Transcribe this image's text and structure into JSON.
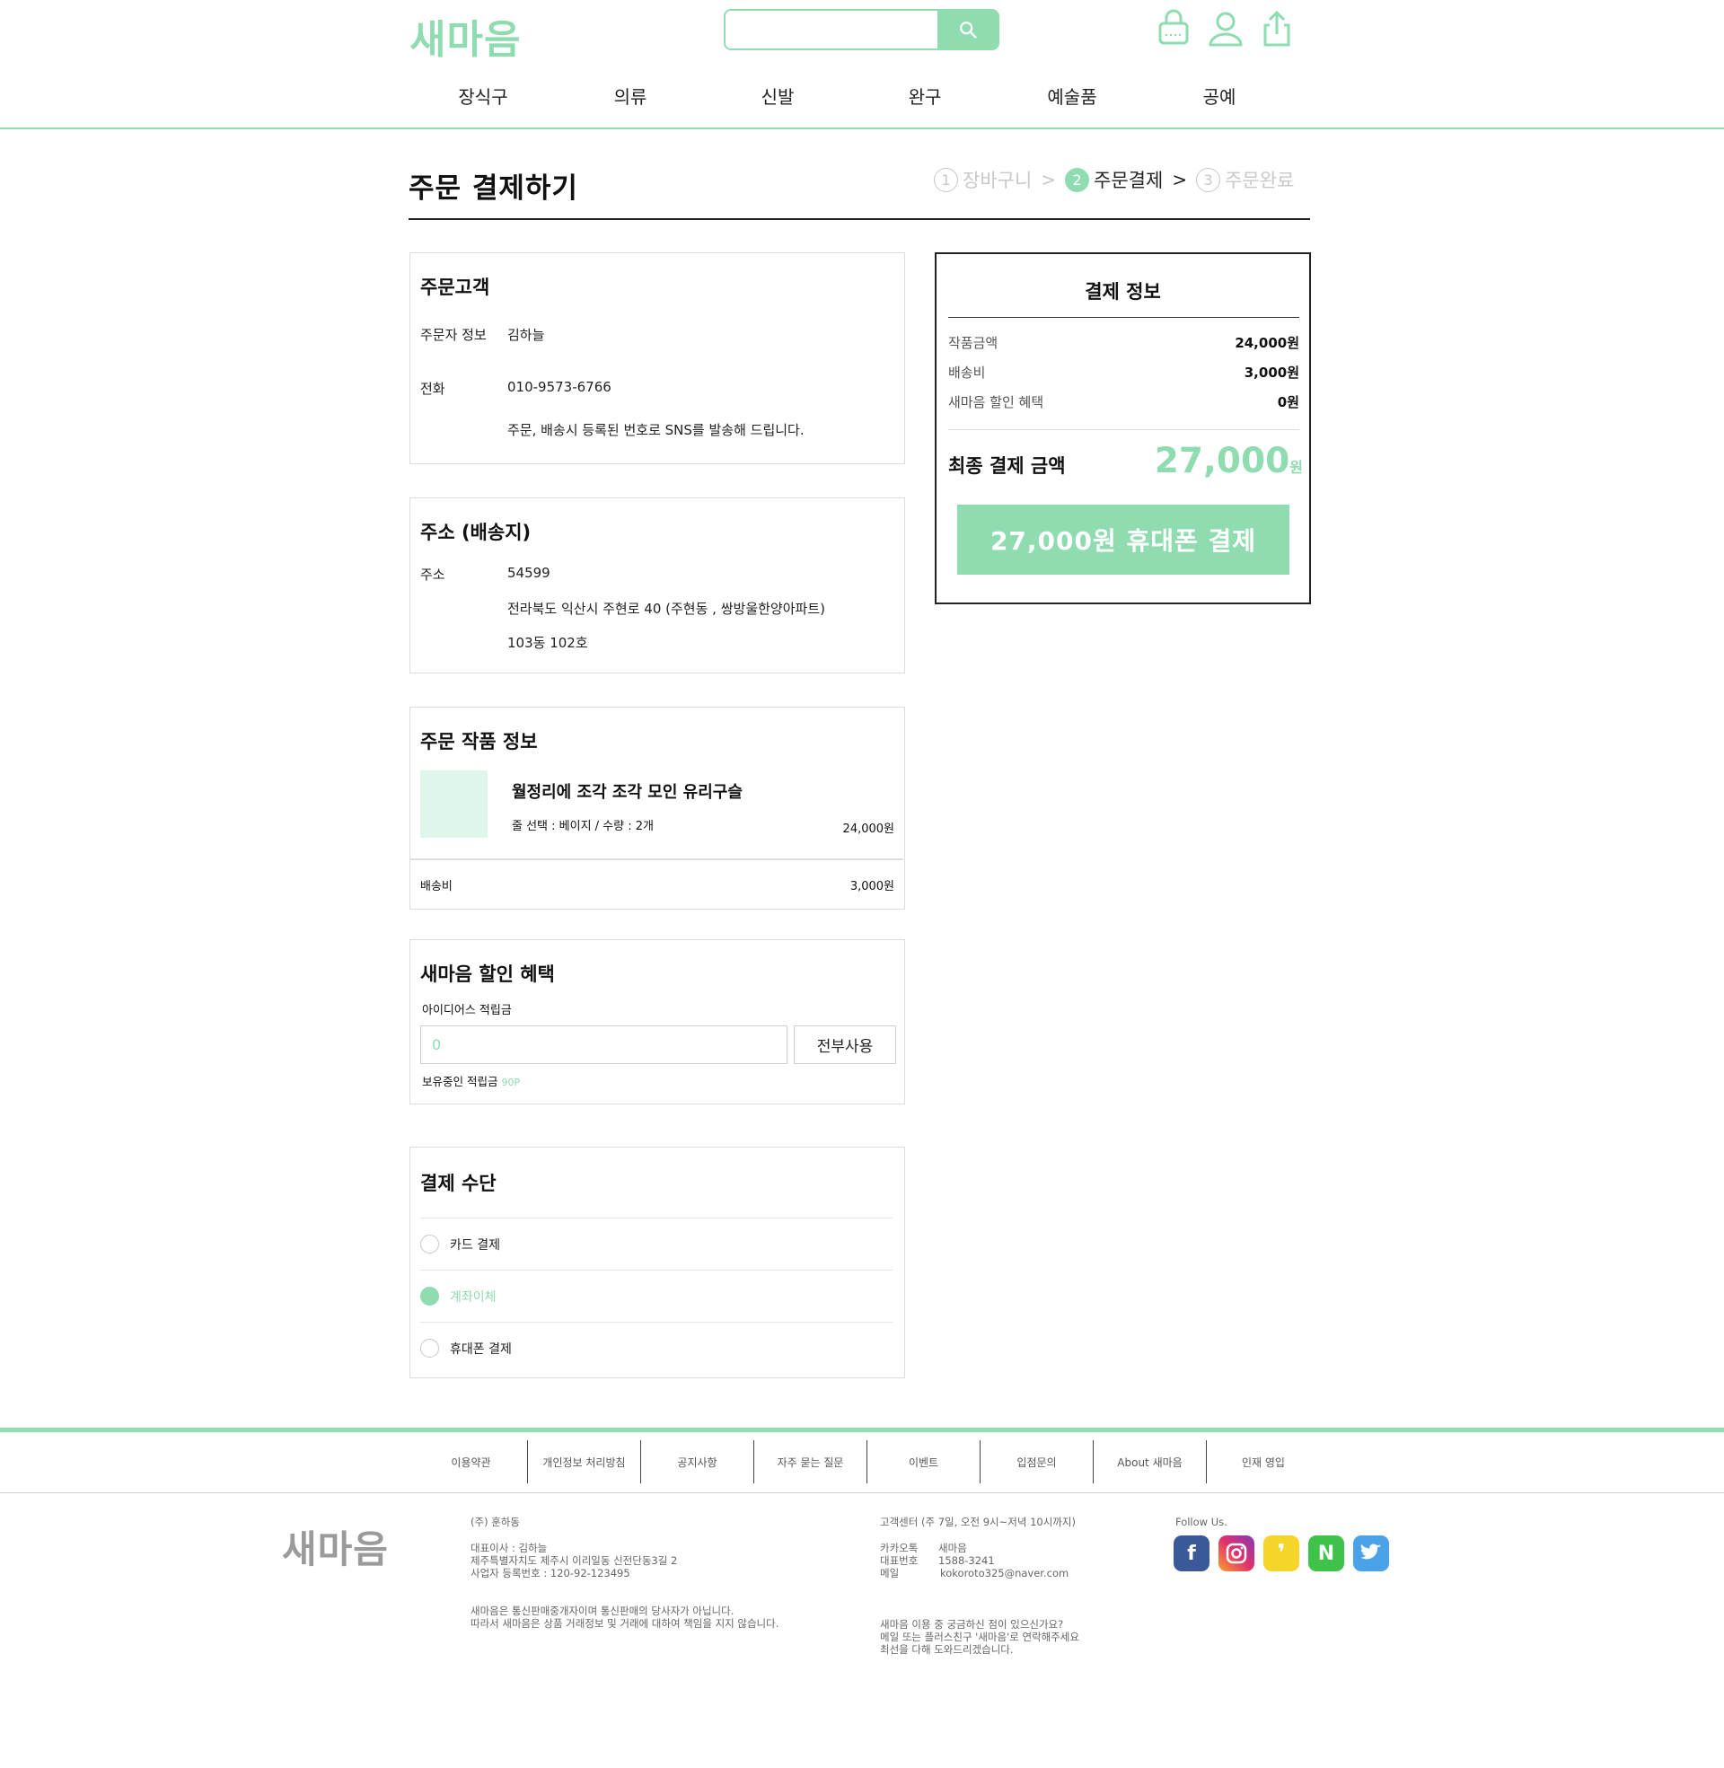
{
  "brand": {
    "logo": "새마음"
  },
  "search": {
    "placeholder": ""
  },
  "nav": [
    "장식구",
    "의류",
    "신발",
    "완구",
    "예술품",
    "공예"
  ],
  "page": {
    "title": "주문 결제하기",
    "steps": [
      {
        "num": "1",
        "label": "장바구니"
      },
      {
        "num": "2",
        "label": "주문결제"
      },
      {
        "num": "3",
        "label": "주문완료"
      }
    ]
  },
  "customer": {
    "title": "주문고객",
    "orderer_label": "주문자 정보",
    "orderer_name": "김하늘",
    "phone_label": "전화",
    "phone": "010-9573-6766",
    "phone_note": "주문, 배송시 등록된 번호로 SNS를 발송해 드립니다."
  },
  "address": {
    "title": "주소 (배송지)",
    "label": "주소",
    "zip": "54599",
    "line1": "전라북도 익산시 주현로 40 (주현동 , 쌍방울한양아파트)",
    "line2": "103동 102호"
  },
  "product": {
    "title": "주문 작품 정보",
    "name": "월정리에 조각 조각 모인 유리구슬",
    "option": "줄 선택 : 베이지 / 수량 : 2개",
    "price": "24,000원",
    "shipping_label": "배송비",
    "shipping": "3,000원"
  },
  "discount": {
    "title": "새마음 할인 혜택",
    "points_label": "아이디어스 적립금",
    "input_placeholder": "0",
    "use_all": "전부사용",
    "held_label": "보유중인 적립금",
    "held_value": "90P"
  },
  "payment_method": {
    "title": "결제 수단",
    "options": [
      "카드 결제",
      "계좌이체",
      "휴대폰 결제"
    ],
    "selected": "계좌이체"
  },
  "summary": {
    "title": "결제 정보",
    "item_label": "작품금액",
    "item_value": "24,000원",
    "ship_label": "배송비",
    "ship_value": "3,000원",
    "discount_label": "새마음 할인 혜택",
    "discount_value": "0원",
    "final_label": "최종 결제 금액",
    "final_amount": "27,000",
    "final_unit": "원",
    "pay_button": "27,000원 휴대폰 결제"
  },
  "footer": {
    "links": [
      "이용약관",
      "개인정보 처리방침",
      "공지사항",
      "자주 묻는 질문",
      "이벤트",
      "입점문의",
      "About 새마음",
      "인재 영입"
    ],
    "logo": "새마음",
    "company": "(주) 훈하동",
    "ceo": "대표이사 : 김하늘",
    "addr": "제주특별자치도 제주시 이리일동 신전단동3길 2",
    "biz": "사업자 등록번호 : 120-92-123495",
    "notice1": "새마음은 통신판매중개자이며 통신판매의 당사자가 아닙니다.",
    "notice2": "따라서 새마음은 상품 거래정보 및 거래에 대하여 책임을 지지 않습니다.",
    "cs_title": "고객센터 (주 7일, 오전 9시~저녁 10시까지)",
    "kakao_label": "카카오톡",
    "kakao_value": "새마음",
    "tel_label": "대표번호",
    "tel_value": "1588-3241",
    "mail_label": "메일",
    "mail_value": "kokoroto325@naver.com",
    "help1": "새마음 이용 중 궁금하신 점이 있으신가요?",
    "help2": "메일 또는 플러스친구 '새마음'로 연락해주세요",
    "help3": "최선을 다해 도와드리겠습니다.",
    "follow": "Follow Us.",
    "social": [
      {
        "icon": "facebook-icon",
        "glyph": "f",
        "color": "#3b5998"
      },
      {
        "icon": "instagram-icon",
        "glyph": "◎",
        "color": "#d6249f"
      },
      {
        "icon": "kakao-icon",
        "glyph": "❜",
        "color": "#f5d52a"
      },
      {
        "icon": "naver-icon",
        "glyph": "N",
        "color": "#3ec24a"
      },
      {
        "icon": "twitter-icon",
        "glyph": "🐦",
        "color": "#4aa3e8"
      }
    ]
  },
  "colors": {
    "accent": "#8fdcb1",
    "thumb": "#dff7ea"
  }
}
